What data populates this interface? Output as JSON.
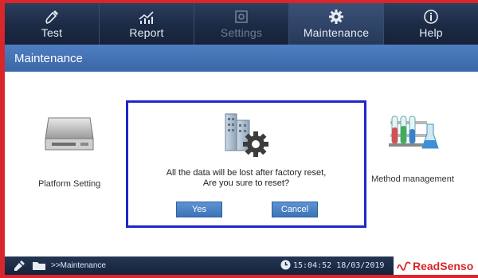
{
  "tabs": [
    {
      "label": "Test",
      "icon": "pipette-icon",
      "state": "normal"
    },
    {
      "label": "Report",
      "icon": "report-chart-icon",
      "state": "normal"
    },
    {
      "label": "Settings",
      "icon": "settings-icon",
      "state": "disabled"
    },
    {
      "label": "Maintenance",
      "icon": "gear-icon",
      "state": "active"
    },
    {
      "label": "Help",
      "icon": "info-icon",
      "state": "normal"
    }
  ],
  "section": {
    "title": "Maintenance"
  },
  "tiles": {
    "platform": {
      "label": "Platform Setting",
      "icon": "platform-device-icon"
    },
    "method": {
      "label": "Method management",
      "icon": "test-tubes-icon"
    }
  },
  "dialog": {
    "icon": "factory-reset-icon",
    "message_line1": "All the data will be lost after factory reset,",
    "message_line2": "Are you sure to reset?",
    "yes_label": "Yes",
    "cancel_label": "Cancel"
  },
  "status": {
    "path": ">>Maintenance",
    "datetime": "15:04:52 18/03/2019"
  },
  "brand": {
    "name": "ReadSenso"
  },
  "colors": {
    "frame_red": "#d8262b",
    "dialog_border": "#1d27c9",
    "header_blue": "#3a67a8",
    "topbar_navy": "#1c2a44"
  }
}
